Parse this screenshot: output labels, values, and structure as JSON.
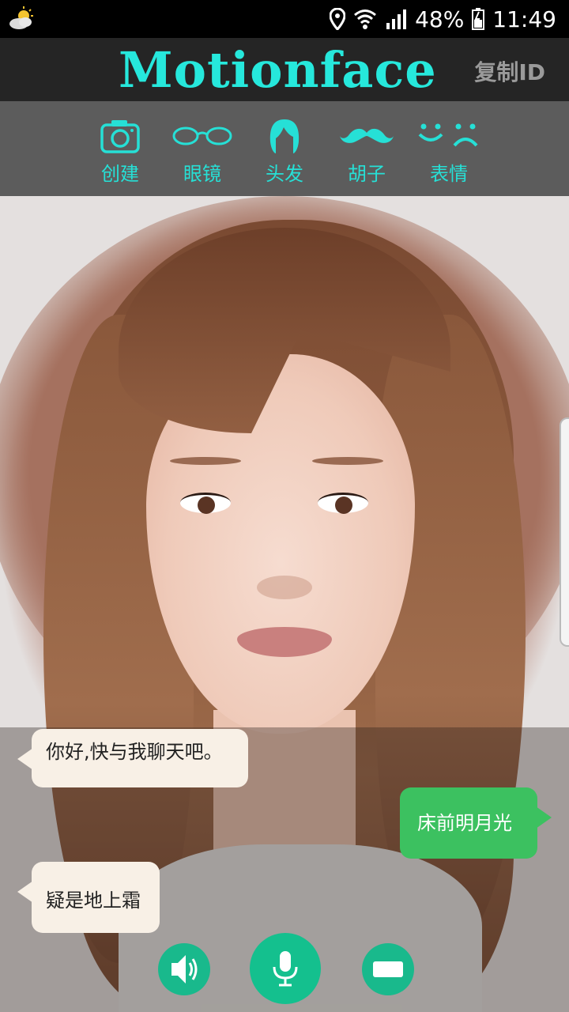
{
  "status_bar": {
    "battery": "48%",
    "time": "11:49"
  },
  "header": {
    "title": "Motionface",
    "copy_id": "复制ID"
  },
  "toolbar": {
    "items": [
      {
        "label": "创建",
        "icon": "camera-icon"
      },
      {
        "label": "眼镜",
        "icon": "glasses-icon"
      },
      {
        "label": "头发",
        "icon": "hair-icon"
      },
      {
        "label": "胡子",
        "icon": "mustache-icon"
      },
      {
        "label": "表情",
        "icon": "expression-icon"
      }
    ]
  },
  "chat": {
    "messages": [
      {
        "side": "in",
        "text": "你好,快与我聊天吧。"
      },
      {
        "side": "out",
        "text": "床前明月光"
      },
      {
        "side": "in",
        "text": "疑是地上霜"
      }
    ]
  },
  "controls": {
    "speaker": "speaker-icon",
    "mic": "microphone-icon",
    "keyboard": "keyboard-icon"
  },
  "colors": {
    "accent": "#26e8dc",
    "button_green": "#19b98c",
    "bubble_out": "#3cc160",
    "bubble_in": "#f8f0e6"
  }
}
